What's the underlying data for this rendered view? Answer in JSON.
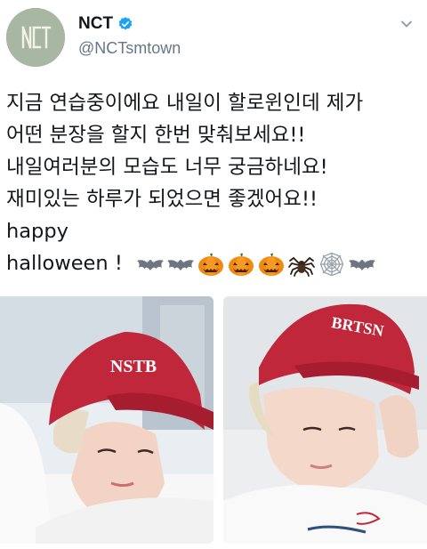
{
  "author": {
    "display_name": "NCT",
    "handle": "@NCTsmtown",
    "avatar_text": "nct"
  },
  "tweet": {
    "lines": [
      "지금 연습중이에요 내일이 할로윈인데 제가",
      "어떤 분장을 할지 한번 맞춰보세요!!",
      "내일여러분의 모습도 너무 궁금하네요!",
      "재미있는 하루가 되었으면 좋겠어요!!",
      "happy",
      "halloween !"
    ],
    "emojis": [
      "bat-icon",
      "bat-icon",
      "pumpkin-icon",
      "pumpkin-icon",
      "pumpkin-icon",
      "spider-icon",
      "spiderweb-icon",
      "bat-icon"
    ]
  },
  "photos": [
    {
      "name": "photo-left",
      "cap_text": "NSTB"
    },
    {
      "name": "photo-right",
      "cap_text": "BRTSN"
    }
  ],
  "colors": {
    "verified": "#1da1f2",
    "handle": "#657786",
    "cap_red": "#c1273a",
    "avatar_bg": "#a7b7a2"
  }
}
